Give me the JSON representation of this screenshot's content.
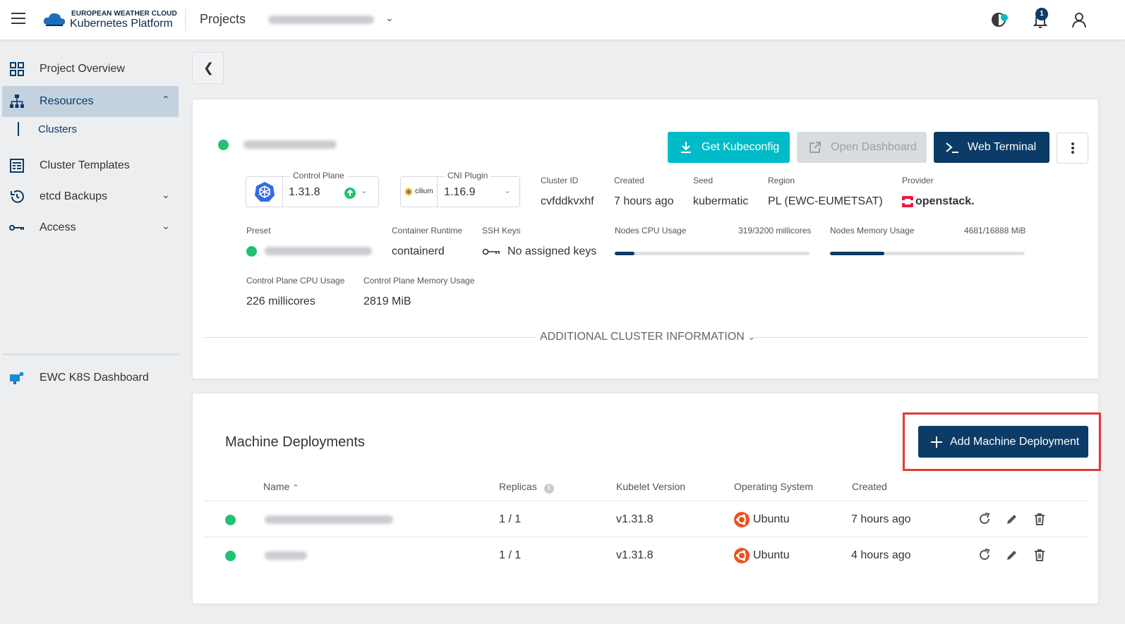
{
  "header": {
    "brand_top": "EUROPEAN WEATHER CLOUD",
    "brand_bottom": "Kubernetes Platform",
    "projects": "Projects",
    "notification_count": "1"
  },
  "sidebar": {
    "items": [
      {
        "label": "Project Overview",
        "icon": "grid-icon"
      },
      {
        "label": "Resources",
        "icon": "hierarchy-icon"
      },
      {
        "label": "Cluster Templates",
        "icon": "template-icon"
      },
      {
        "label": "etcd Backups",
        "icon": "history-icon"
      },
      {
        "label": "Access",
        "icon": "key-icon"
      }
    ],
    "sub_item": "Clusters",
    "bottom_item": "EWC K8S Dashboard"
  },
  "cluster": {
    "buttons": {
      "kubeconfig": "Get Kubeconfig",
      "dashboard": "Open Dashboard",
      "terminal": "Web Terminal"
    },
    "control_plane": {
      "label": "Control Plane",
      "value": "1.31.8"
    },
    "cni_plugin": {
      "label": "CNI Plugin",
      "value": "1.16.9",
      "logo_text": "cilium"
    },
    "cluster_id": {
      "label": "Cluster ID",
      "value": "cvfddkvxhf"
    },
    "created": {
      "label": "Created",
      "value": "7 hours ago"
    },
    "seed": {
      "label": "Seed",
      "value": "kubermatic"
    },
    "region": {
      "label": "Region",
      "value": "PL (EWC-EUMETSAT)"
    },
    "provider": {
      "label": "Provider",
      "value": "openstack."
    },
    "preset": {
      "label": "Preset"
    },
    "container_runtime": {
      "label": "Container Runtime",
      "value": "containerd"
    },
    "ssh_keys": {
      "label": "SSH Keys",
      "value": "No assigned keys"
    },
    "nodes_cpu": {
      "label": "Nodes CPU Usage",
      "value": "319/3200 millicores",
      "fraction": 0.1
    },
    "nodes_memory": {
      "label": "Nodes Memory Usage",
      "value": "4681/16888 MiB",
      "fraction": 0.28
    },
    "cp_cpu": {
      "label": "Control Plane CPU Usage",
      "value": "226 millicores"
    },
    "cp_memory": {
      "label": "Control Plane Memory Usage",
      "value": "2819 MiB"
    },
    "additional_info": "ADDITIONAL CLUSTER INFORMATION"
  },
  "machine_deployments": {
    "title": "Machine Deployments",
    "add_button": "Add Machine Deployment",
    "columns": [
      "Name",
      "Replicas",
      "Kubelet Version",
      "Operating System",
      "Created"
    ],
    "rows": [
      {
        "replicas": "1 / 1",
        "kubelet": "v1.31.8",
        "os": "Ubuntu",
        "created": "7 hours ago"
      },
      {
        "replicas": "1 / 1",
        "kubelet": "v1.31.8",
        "os": "Ubuntu",
        "created": "4 hours ago"
      }
    ]
  },
  "colors": {
    "primary": "#0b3b66",
    "teal": "#00bcc9",
    "status_green": "#20c272",
    "highlight_red": "#e03a3a"
  }
}
